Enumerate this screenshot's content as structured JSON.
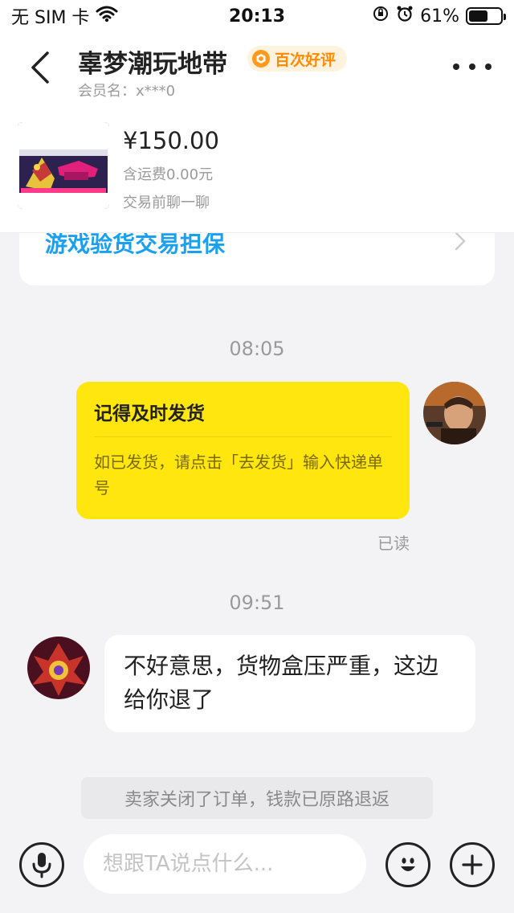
{
  "status_bar": {
    "carrier": "无 SIM 卡",
    "time": "20:13",
    "battery": "61%",
    "battery_level": 0.61
  },
  "header": {
    "shop_name": "辜梦潮玩地带",
    "badge": "百次好评",
    "member_label": "会员名：x***0"
  },
  "product": {
    "price": "¥150.00",
    "shipping": "含运费0.00元",
    "note": "交易前聊一聊"
  },
  "guarantee": {
    "text": "游戏验货交易担保"
  },
  "messages": {
    "time_1": "08:05",
    "notice_title": "记得及时发货",
    "notice_body": "如已发货，请点击「去发货」输入快递单号",
    "read_status": "已读",
    "time_2": "09:51",
    "incoming_text": "不好意思，货物盒压严重，这边给你退了",
    "system_notice": "卖家关闭了订单，钱款已原路退返"
  },
  "input": {
    "placeholder": "想跟TA说点什么..."
  },
  "icons": {
    "back": "chevron-left-icon",
    "more": "more-dots-icon",
    "voice": "microphone-icon",
    "emoji": "emoji-icon",
    "plus": "plus-icon",
    "wifi": "wifi-icon",
    "alarm": "alarm-icon",
    "lock": "orientation-lock-icon"
  },
  "colors": {
    "notice_yellow": "#ffe60f",
    "guarantee_blue": "#1aa0f0",
    "badge_orange": "#ff8a00"
  }
}
